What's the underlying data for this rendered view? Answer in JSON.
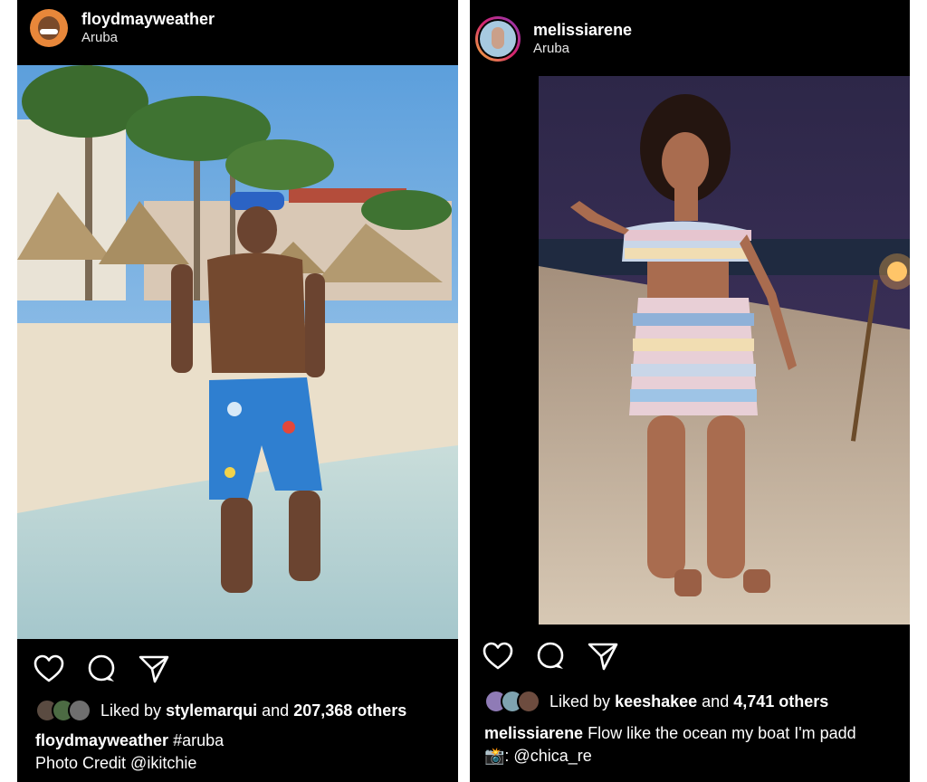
{
  "posts": [
    {
      "username": "floydmayweather",
      "location": "Aruba",
      "likes": {
        "prefix": "Liked by",
        "user": "stylemarqui",
        "middle": "and",
        "count": "207,368 others"
      },
      "caption": {
        "username": "floydmayweather",
        "text": "#aruba",
        "line2": "Photo Credit @ikitchie"
      }
    },
    {
      "username": "melissiarene",
      "location": "Aruba",
      "likes": {
        "prefix": "Liked by",
        "user": "keeshakee",
        "middle": "and",
        "count": "4,741 others"
      },
      "caption": {
        "username": "melissiarene",
        "text": "Flow like the ocean my boat I'm padd",
        "camera": "📸",
        "line2": ": @chica_re"
      }
    }
  ],
  "icons": [
    "heart-icon",
    "comment-icon",
    "share-icon",
    "camera-emoji"
  ],
  "colors": {
    "background": "#000000",
    "text": "#ffffff",
    "sky": "#6fa8dc",
    "sand": "#eadfca"
  }
}
